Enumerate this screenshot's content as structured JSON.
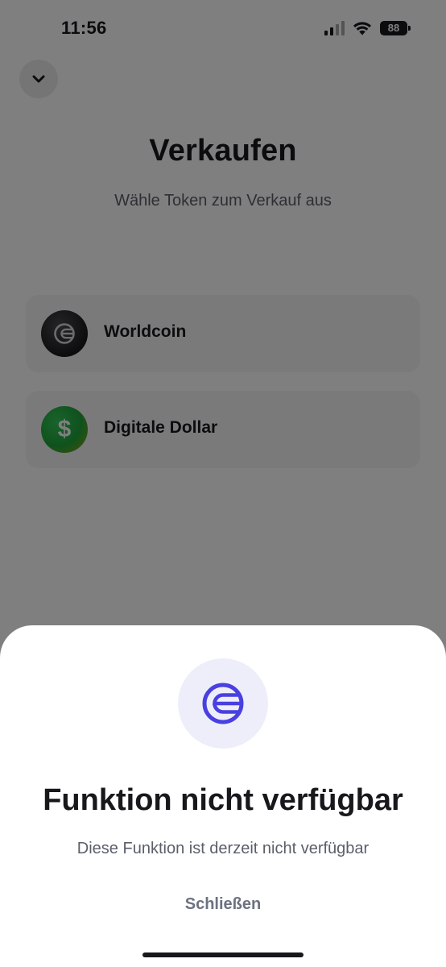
{
  "status_bar": {
    "time": "11:56",
    "battery": "88",
    "icons": [
      "signal-icon",
      "wifi-icon",
      "battery-icon"
    ]
  },
  "header": {
    "back_icon": "chevron-down-icon",
    "title": "Verkaufen",
    "subtitle": "Wähle Token zum Verkauf aus"
  },
  "tokens": [
    {
      "name": "Worldcoin",
      "icon": "worldcoin-icon"
    },
    {
      "name": "Digitale Dollar",
      "icon": "dollar-icon",
      "symbol": "$"
    }
  ],
  "sheet": {
    "icon": "worldcoin-icon",
    "title": "Funktion nicht verfügbar",
    "message": "Diese Funktion ist derzeit nicht verfügbar",
    "close_label": "Schließen"
  },
  "colors": {
    "accent": "#4940e0",
    "text_primary": "#17181c",
    "text_secondary": "#5a5f6a",
    "dollar_green": "#1ea43a"
  }
}
